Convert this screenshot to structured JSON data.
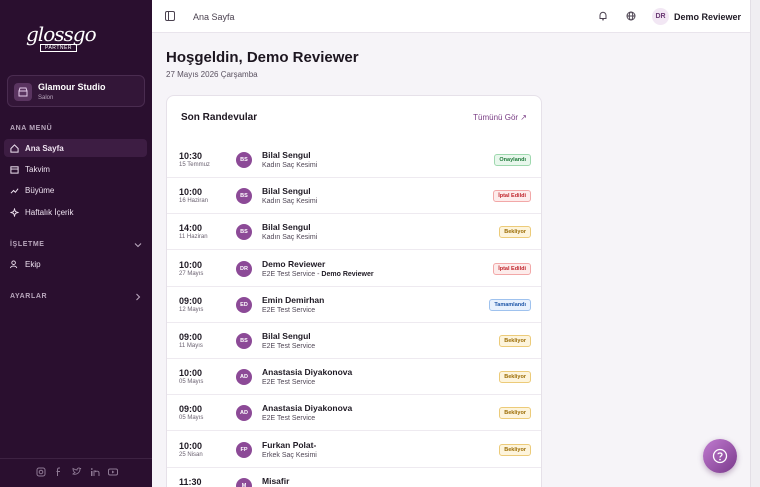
{
  "brand": {
    "logo_word": "glossgo",
    "logo_sub": "PARTNER"
  },
  "studio": {
    "name": "Glamour Studio",
    "type": "Salon"
  },
  "sidebar": {
    "main_menu_title": "ANA MENÜ",
    "items": [
      {
        "label": "Ana Sayfa",
        "icon": "home-icon",
        "active": true
      },
      {
        "label": "Takvim",
        "icon": "calendar-icon"
      },
      {
        "label": "Büyüme",
        "icon": "trending-up-icon"
      },
      {
        "label": "Haftalık İçerik",
        "icon": "sparkles-icon"
      }
    ],
    "business_title": "İŞLETME",
    "business_items": [
      {
        "label": "Ekip",
        "icon": "users-icon"
      }
    ],
    "settings_title": "AYARLAR"
  },
  "header": {
    "breadcrumb": "Ana Sayfa",
    "avatar_initials": "DR",
    "user_name": "Demo Reviewer"
  },
  "main": {
    "greeting": "Hoşgeldin, Demo Reviewer",
    "date": "27 Mayıs 2026 Çarşamba"
  },
  "appointments": {
    "title": "Son Randevular",
    "see_all": "Tümünü Gör ↗",
    "rows": [
      {
        "time": "10:30",
        "day": "15 Temmuz",
        "initials": "BS",
        "name": "Bilal Sengul",
        "service": "Kadın Saç Kesimi",
        "status": "Onaylandı",
        "status_kind": "confirmed"
      },
      {
        "time": "10:00",
        "day": "16 Haziran",
        "initials": "BS",
        "name": "Bilal Sengul",
        "service": "Kadın Saç Kesimi",
        "status": "İptal Edildi",
        "status_kind": "cancelled"
      },
      {
        "time": "14:00",
        "day": "11 Haziran",
        "initials": "BS",
        "name": "Bilal Sengul",
        "service": "Kadın Saç Kesimi",
        "status": "Bekliyor",
        "status_kind": "pending"
      },
      {
        "time": "10:00",
        "day": "27 Mayıs",
        "initials": "DR",
        "name": "Demo Reviewer",
        "service": "E2E Test Service",
        "staff": "Demo Reviewer",
        "status": "İptal Edildi",
        "status_kind": "cancelled"
      },
      {
        "time": "09:00",
        "day": "12 Mayıs",
        "initials": "ED",
        "name": "Emin Demirhan",
        "service": "E2E Test Service",
        "status": "Tamamlandı",
        "status_kind": "completed"
      },
      {
        "time": "09:00",
        "day": "11 Mayıs",
        "initials": "BS",
        "name": "Bilal Sengul",
        "service": "E2E Test Service",
        "status": "Bekliyor",
        "status_kind": "pending"
      },
      {
        "time": "10:00",
        "day": "05 Mayıs",
        "initials": "AD",
        "name": "Anastasia Diyakonova",
        "service": "E2E Test Service",
        "status": "Bekliyor",
        "status_kind": "pending"
      },
      {
        "time": "09:00",
        "day": "05 Mayıs",
        "initials": "AD",
        "name": "Anastasia Diyakonova",
        "service": "E2E Test Service",
        "status": "Bekliyor",
        "status_kind": "pending"
      },
      {
        "time": "10:00",
        "day": "25 Nisan",
        "initials": "FP",
        "name": "Furkan Polat-",
        "service": "Erkek Saç Kesimi",
        "status": "Bekliyor",
        "status_kind": "pending"
      },
      {
        "time": "11:30",
        "day": "",
        "initials": "M",
        "name": "Misafir",
        "service": "",
        "status": "",
        "status_kind": "pending"
      }
    ]
  },
  "colors": {
    "sidebar_bg": "#2a0f2f",
    "accent": "#7a3d85",
    "avatar_bg": "#8c4a97"
  }
}
